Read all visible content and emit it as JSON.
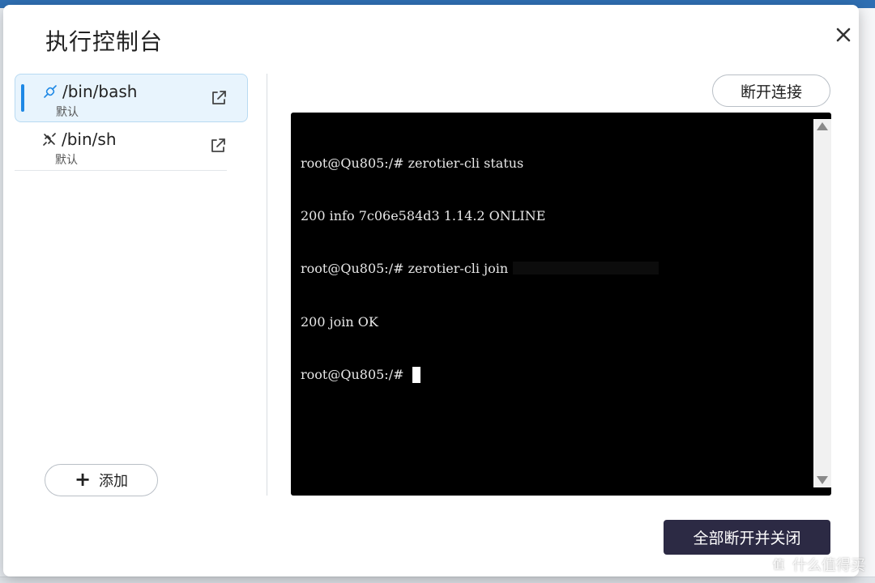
{
  "dialog": {
    "title": "执行控制台",
    "close_icon": "close-icon"
  },
  "sidebar": {
    "items": [
      {
        "name": "/bin/bash",
        "subtitle": "默认",
        "icon": "connected-plug-icon",
        "action_icon": "open-external-icon",
        "active": true
      },
      {
        "name": "/bin/sh",
        "subtitle": "默认",
        "icon": "disconnected-plug-icon",
        "action_icon": "open-external-icon",
        "active": false
      }
    ],
    "add_label": "添加"
  },
  "toolbar": {
    "disconnect_label": "断开连接"
  },
  "terminal": {
    "lines": [
      "root@Qu805:/# zerotier-cli status",
      "200 info 7c06e584d3 1.14.2 ONLINE",
      "root@Qu805:/# zerotier-cli join",
      "200 join OK",
      "root@Qu805:/#"
    ]
  },
  "footer": {
    "close_all_label": "全部断开并关闭"
  },
  "watermark": {
    "logo": "值",
    "text": "什么值得买"
  },
  "colors": {
    "accent": "#1e88e5",
    "active_bg": "#e8f4fd",
    "primary_button": "#2c2a44",
    "terminal_bg": "#000000"
  }
}
